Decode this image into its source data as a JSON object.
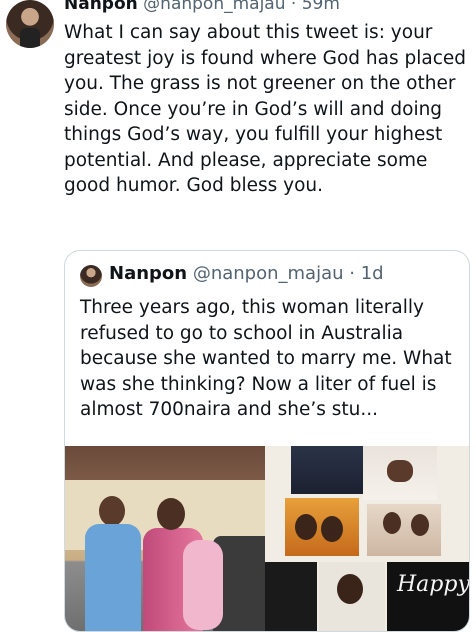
{
  "tweet": {
    "name": "Nanpon",
    "handle": "@nanpon_majau",
    "separator": "·",
    "time": "59m",
    "text": "What I can say about this tweet is: your greatest joy is found where God has placed you. The grass is not greener on the other side. Once you’re in God’s will and doing things God’s way, you fulfill your highest potential. And please, appreciate some good humor. God bless you."
  },
  "quoted_tweet": {
    "name": "Nanpon",
    "handle": "@nanpon_majau",
    "separator": "·",
    "time": "1d",
    "text": "Three years ago, this woman literally refused to go to school in Australia because she wanted to marry me. What was she thinking? Now a liter of fuel is almost 700naira and she’s stu..."
  },
  "media": {
    "collage_caption": "Happy"
  },
  "colors": {
    "text_primary": "#0f1419",
    "text_secondary": "#536471",
    "border": "#cfd9de"
  }
}
